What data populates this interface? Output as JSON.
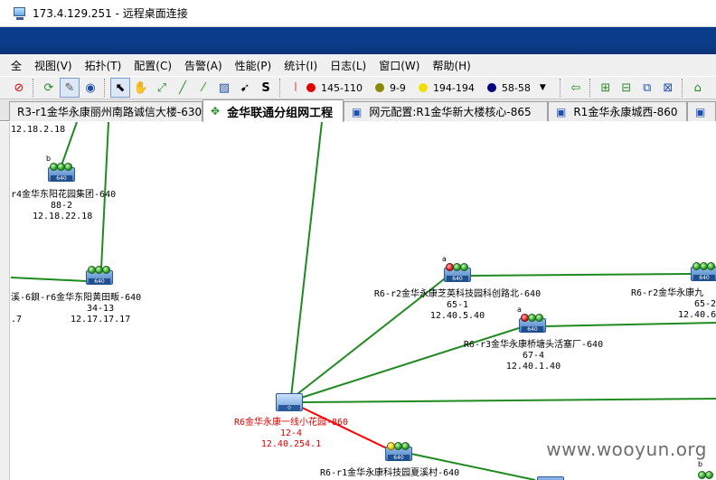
{
  "remote_window": {
    "title": "173.4.129.251 - 远程桌面连接"
  },
  "menu": [
    "全",
    "视图(V)",
    "拓扑(T)",
    "配置(C)",
    "告警(A)",
    "性能(P)",
    "统计(I)",
    "日志(L)",
    "窗口(W)",
    "帮助(H)"
  ],
  "toolbar": {
    "text_tool": "S",
    "alarm_counts": [
      {
        "color": "#e00000",
        "label": "145-110"
      },
      {
        "color": "#8a8a00",
        "label": "9-9"
      },
      {
        "color": "#f0e000",
        "label": "194-194"
      },
      {
        "color": "#000080",
        "label": "58-58"
      }
    ],
    "dropdown": "▼"
  },
  "tabs": [
    {
      "label": "R3-r1金华永康丽州南路诚信大楼-630",
      "icon": ""
    },
    {
      "label": "金华联通分组网工程",
      "icon": "✥",
      "active": true
    },
    {
      "label": "网元配置:R1金华新大楼核心-865",
      "icon": "▣"
    },
    {
      "label": "R1金华永康城西-860",
      "icon": "▣"
    },
    {
      "label": "",
      "icon": "▣"
    }
  ],
  "nodes": [
    {
      "id": "n0",
      "tag": "",
      "lines": [
        "12.18.2.18"
      ]
    },
    {
      "id": "n1",
      "tag": "b",
      "leds": [
        "green",
        "green",
        "green"
      ],
      "lines": [
        "r4金华东阳花园集团-640",
        "88-2",
        "12.18.22.18"
      ]
    },
    {
      "id": "n2",
      "tag": "",
      "leds": [
        "green",
        "green",
        "green"
      ],
      "lines": [
        "溪-6鋇-r6金华东阳黄田畈-640",
        "34-13",
        "12.17.17.17"
      ]
    },
    {
      "id": "n2b",
      "tag": "",
      "lines": [
        ".7"
      ]
    },
    {
      "id": "n3",
      "tag": "a",
      "leds": [
        "red",
        "green",
        "green"
      ],
      "lines": [
        "R6-r2金华永康芝英科技园科创路北-640",
        "65-1",
        "12.40.5.40"
      ]
    },
    {
      "id": "n4",
      "tag": "a",
      "leds": [
        "red",
        "green",
        "green"
      ],
      "lines": [
        "R6-r3金华永康桥塘头活塞厂-640",
        "67-4",
        "12.40.1.40"
      ]
    },
    {
      "id": "n5",
      "tag": "",
      "leds": [
        "green",
        "green",
        "green"
      ],
      "lines": [
        "R6-r2金华永康九",
        "65-2",
        "12.40.6"
      ]
    },
    {
      "id": "n6",
      "tag": "",
      "core": true,
      "lines": [
        "R6金华永康一线小花园-860",
        "12-4",
        "12.40.254.1"
      ]
    },
    {
      "id": "n7",
      "tag": "",
      "leds": [
        "yellow",
        "green",
        "green"
      ],
      "lines": [
        "R6-r1金华永康科技园夏溪村-640"
      ]
    },
    {
      "id": "n8",
      "tag": "b",
      "leds": [
        "green",
        "green"
      ],
      "lines": []
    }
  ],
  "watermark": "www.wooyun.org",
  "colors": {
    "link": "#1f8a1f",
    "alert_link": "#ff0000",
    "alert_text": "#e00000"
  }
}
